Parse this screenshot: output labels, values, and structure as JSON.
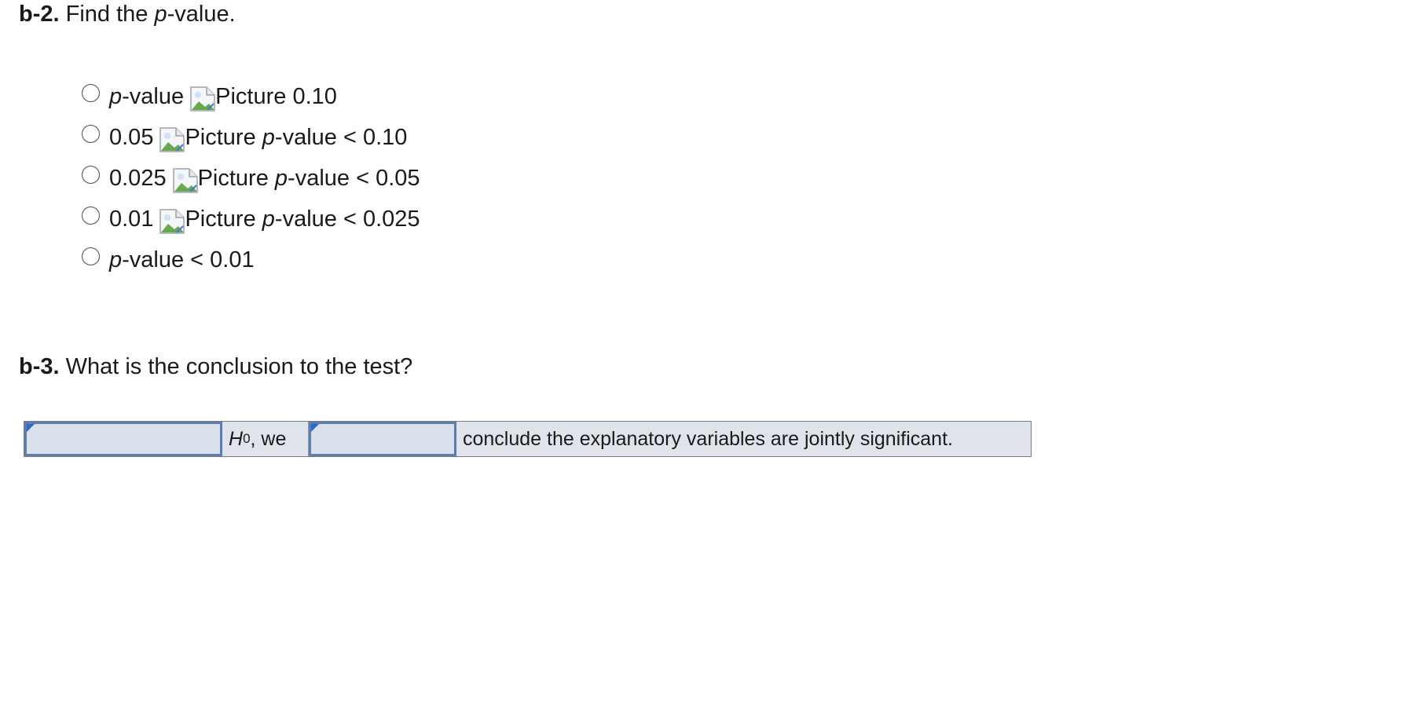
{
  "b2": {
    "number": "b-2.",
    "prompt_before": "Find the ",
    "prompt_var": "p",
    "prompt_after": "-value."
  },
  "options": [
    {
      "pre": "",
      "pre_italic": "p",
      "pre_rest": "-value",
      "img_alt": "Picture",
      "post": "0.10"
    },
    {
      "pre": "0.05",
      "img_alt": "Picture",
      "post_italic": "p",
      "post": "-value < 0.10"
    },
    {
      "pre": "0.025",
      "img_alt": "Picture",
      "post_italic": "p",
      "post": "-value < 0.05"
    },
    {
      "pre": "0.01",
      "img_alt": "Picture",
      "post_italic": "p",
      "post": "-value < 0.025"
    },
    {
      "pre_italic": "p",
      "pre_rest": "-value < 0.01"
    }
  ],
  "b3": {
    "number": "b-3.",
    "prompt": "What is the conclusion to the test?"
  },
  "answer_row": {
    "dropdown1_value": "",
    "h0_var": "H",
    "h0_sub": "0",
    "h0_rest": ", we",
    "dropdown2_value": "",
    "conclusion": "conclude the explanatory variables are jointly significant."
  },
  "icons": {
    "broken_image": "broken-image-icon",
    "dropdown_marker": "dropdown-corner-icon"
  },
  "colors": {
    "dropdown_border": "#5b7db1",
    "dropdown_marker": "#2a6ac9",
    "row_background": "#dfe3ea"
  }
}
